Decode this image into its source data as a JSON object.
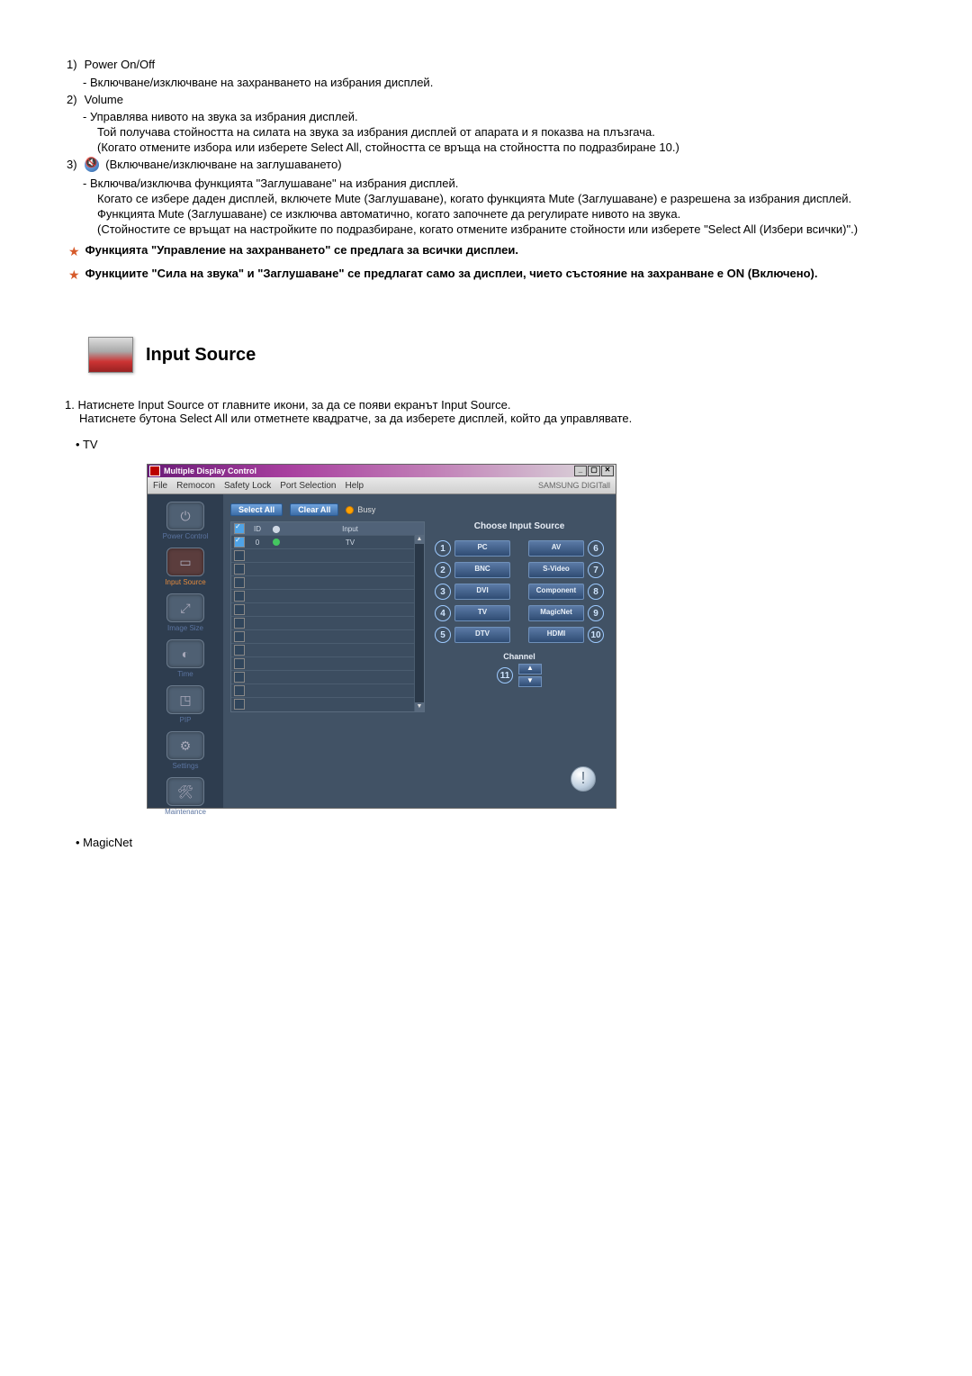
{
  "items": {
    "i1_num": "1)",
    "i1_title": "Power On/Off",
    "i1_line1": "- Включване/изключване на захранването на избрания дисплей.",
    "i2_num": "2)",
    "i2_title": "Volume",
    "i2_line1": "- Управлява нивото на звука за избрания дисплей.",
    "i2_line2": "Той получава стойността на силата на звука за избрания дисплей от апарата и я показва на плъзгача.",
    "i2_line3": "(Когато отмените избора или изберете Select All, стойността се връща на стойността по подразбиране 10.)",
    "i3_num": "3)",
    "i3_title": "(Включване/изключване на заглушаването)",
    "i3_line1": "- Включва/изключва функцията \"Заглушаване\" на избрания дисплей.",
    "i3_line2": "Когато се избере даден дисплей, включете Mute (Заглушаване), когато функцията Mute (Заглушаване) е разрешена за избрания дисплей.",
    "i3_line3": "Функцията Mute (Заглушаване) се изключва автоматично, когато започнете да регулирате нивото на звука.",
    "i3_line4": "(Стойностите се връщат на настройките по подразбиране, когато отмените избраните стойности или изберете \"Select All (Избери всички)\".)"
  },
  "notes": {
    "n1": "Функцията \"Управление на захранването\" се предлага за всички дисплеи.",
    "n2": "Функциите \"Сила на звука\" и \"Заглушаване\" се предлагат само за дисплеи, чието състояние на захранване е ON (Включено)."
  },
  "section_title": "Input Source",
  "ol": {
    "o1": "1.  Натиснете Input Source от главните икони, за да се появи екранът Input Source.",
    "o1b": "Натиснете бутона Select All или отметнете квадратче, за да изберете дисплей, който да управлявате."
  },
  "bullet_tv": "TV",
  "bullet_magicnet": "MagicNet",
  "app": {
    "title": "Multiple Display Control",
    "menu": {
      "file": "File",
      "remocon": "Remocon",
      "safety": "Safety Lock",
      "port": "Port Selection",
      "help": "Help"
    },
    "brand": "SAMSUNG DIGITall",
    "sidebar": {
      "power": "Power Control",
      "input": "Input Source",
      "image": "Image Size",
      "time": "Time",
      "pip": "PIP",
      "settings": "Settings",
      "maint": "Maintenance"
    },
    "buttons": {
      "select_all": "Select All",
      "clear_all": "Clear All",
      "busy": "Busy"
    },
    "grid": {
      "id_hdr": "ID",
      "input_hdr": "Input",
      "row0_id": "0",
      "row0_input": "TV"
    },
    "panel_title": "Choose Input Source",
    "sources": {
      "pc": "PC",
      "bnc": "BNC",
      "dvi": "DVI",
      "tv": "TV",
      "dtv": "DTV",
      "av": "AV",
      "svideo": "S-Video",
      "component": "Component",
      "magicnet": "MagicNet",
      "hdmi": "HDMI"
    },
    "nums": {
      "n1": "1",
      "n2": "2",
      "n3": "3",
      "n4": "4",
      "n5": "5",
      "n6": "6",
      "n7": "7",
      "n8": "8",
      "n9": "9",
      "n10": "10",
      "n11": "11"
    },
    "channel_title": "Channel"
  }
}
